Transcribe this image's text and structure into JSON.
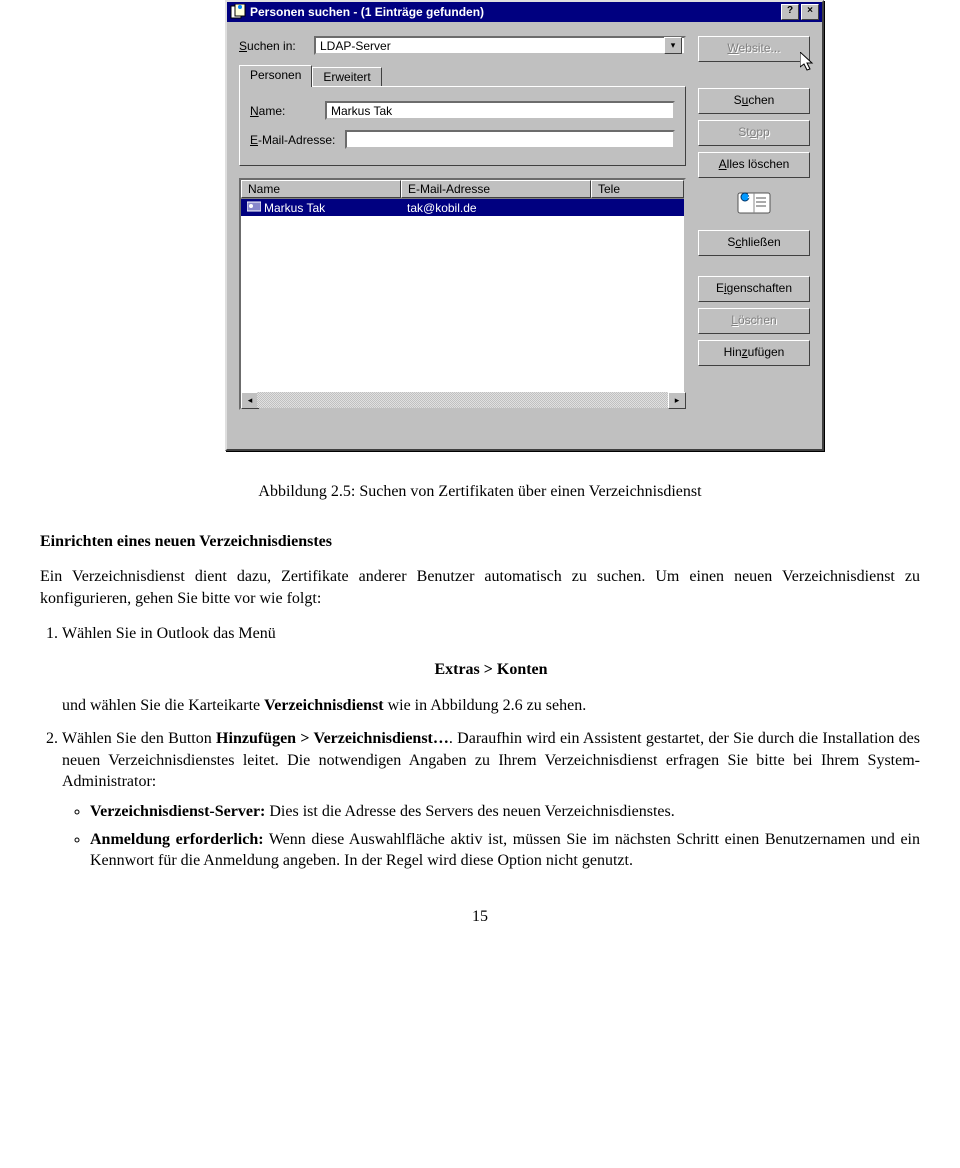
{
  "dialog": {
    "title": "Personen suchen - (1 Einträge gefunden)",
    "searchin_label": "Suchen in:",
    "searchin_value": "LDAP-Server",
    "tab_people": "Personen",
    "tab_advanced": "Erweitert",
    "name_label": "Name:",
    "name_value": "Markus Tak",
    "email_label": "E-Mail-Adresse:",
    "email_value": "",
    "btn_website": "Website...",
    "btn_search": "Suchen",
    "btn_stop": "Stopp",
    "btn_clear": "Alles löschen",
    "btn_close": "Schließen",
    "btn_props": "Eigenschaften",
    "btn_delete": "Löschen",
    "btn_add": "Hinzufügen",
    "columns": {
      "name": "Name",
      "email": "E-Mail-Adresse",
      "tel": "Tele"
    },
    "results": [
      {
        "name": "Markus Tak",
        "email": "tak@kobil.de",
        "tel": ""
      }
    ]
  },
  "caption": "Abbildung 2.5: Suchen von Zertifikaten über einen Verzeichnisdienst",
  "subhead": "Einrichten eines neuen Verzeichnisdienstes",
  "para1": "Ein Verzeichnisdienst dient dazu, Zertifikate anderer Benutzer automatisch zu suchen. Um einen neuen Verzeichnisdienst zu konfigurieren, gehen Sie bitte vor wie folgt:",
  "step1_a": "Wählen Sie in Outlook das Menü",
  "menu_path": "Extras > Konten",
  "step1_b_pre": "und wählen Sie die Karteikarte ",
  "step1_b_bold": "Verzeichnisdienst",
  "step1_b_post": " wie in Abbildung 2.6 zu sehen.",
  "step2_pre": "Wählen Sie den Button ",
  "step2_bold": "Hinzufügen > Verzeichnisdienst…",
  "step2_post": ". Daraufhin wird ein Assistent gestartet, der Sie durch die Installation des neuen Verzeichnisdienstes leitet. Die notwendigen Angaben zu Ihrem Verzeichnisdienst erfragen Sie bitte bei Ihrem System-Administrator:",
  "bullet1_bold": "Verzeichnisdienst-Server:",
  "bullet1_rest": " Dies ist die Adresse des Servers des neuen Verzeichnisdienstes.",
  "bullet2_bold": "Anmeldung erforderlich:",
  "bullet2_rest": " Wenn diese Auswahlfläche aktiv ist, müssen Sie im nächsten Schritt einen Benutzernamen und ein Kennwort für die Anmeldung angeben. In der Regel wird diese Option nicht genutzt.",
  "page_num": "15"
}
